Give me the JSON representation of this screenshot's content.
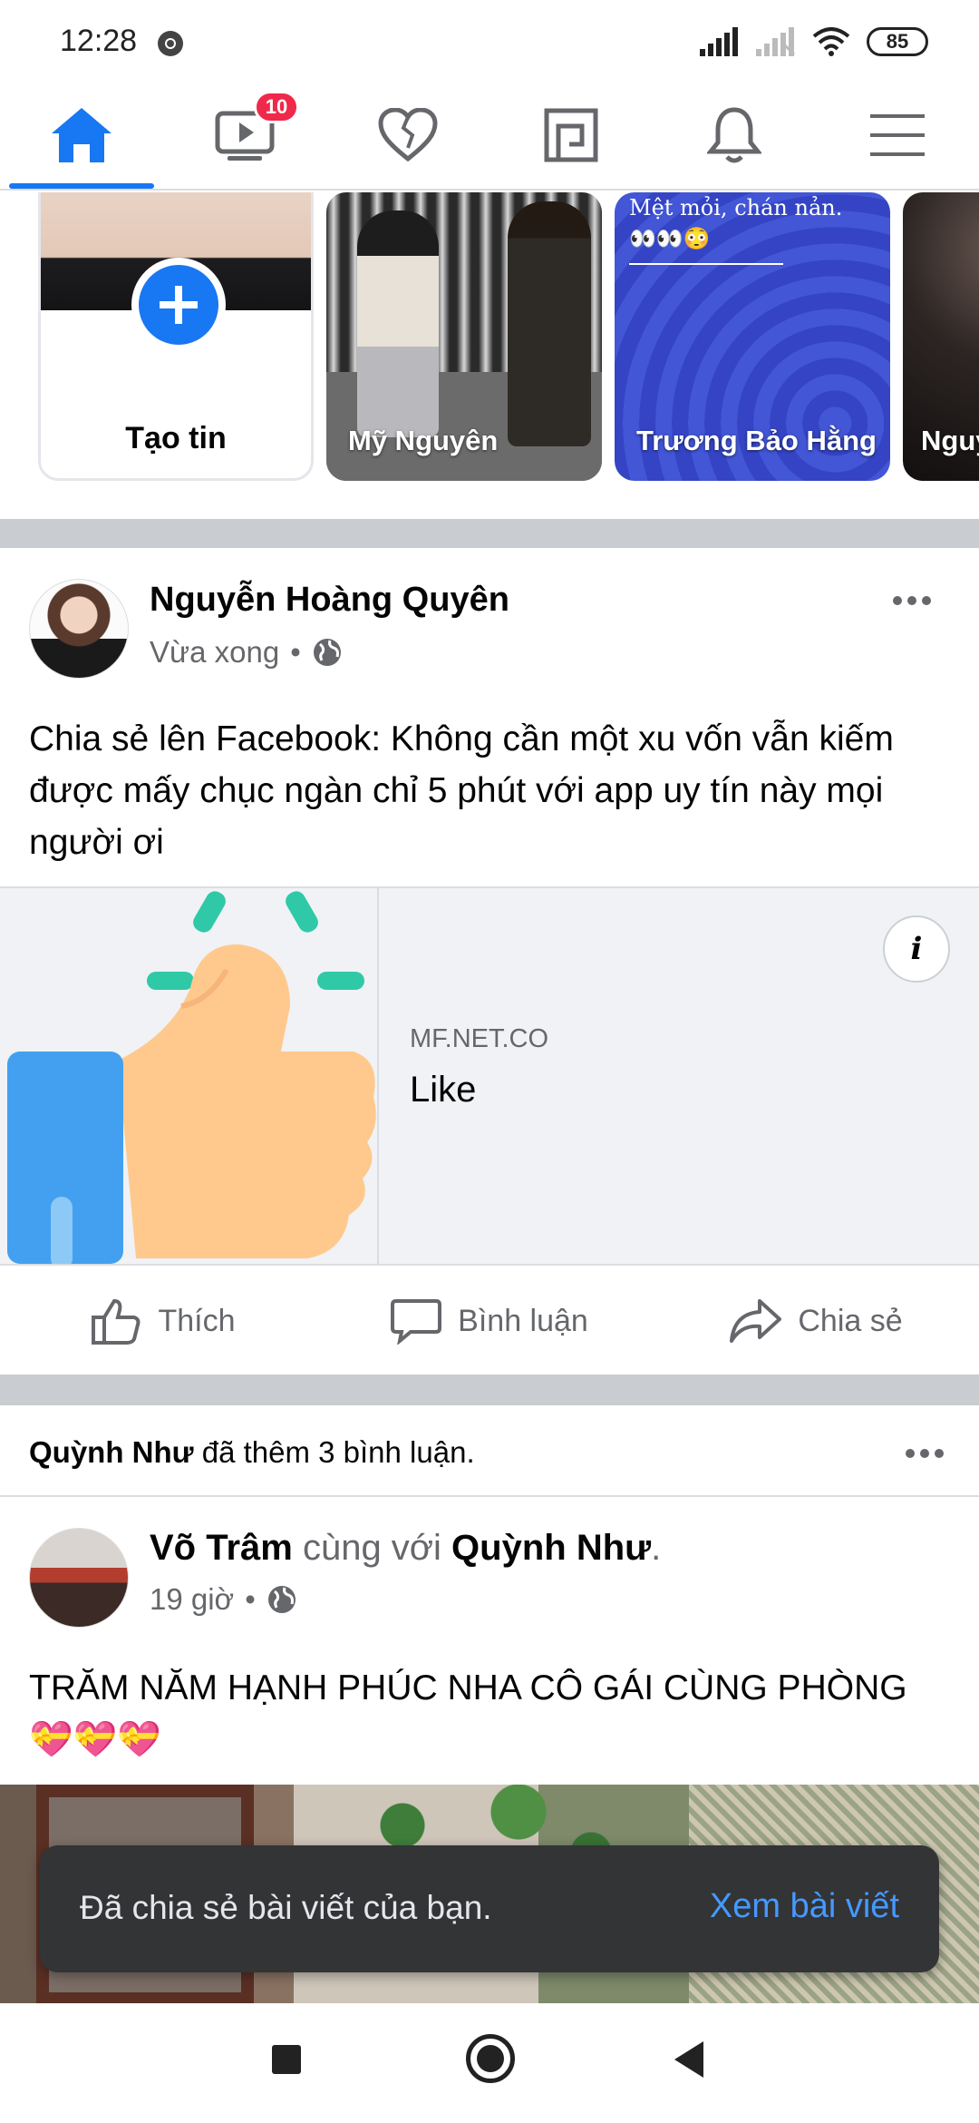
{
  "status_bar": {
    "time": "12:28",
    "battery": "85"
  },
  "nav": {
    "watch_badge": "10"
  },
  "stories": [
    {
      "label": "Tạo tin"
    },
    {
      "name": "Mỹ Nguyên"
    },
    {
      "name": "Trương Bảo Hằng",
      "caption": "Mệt mỏi, chán nản.",
      "caption_emoji": "👀👀😳"
    },
    {
      "name": "Nguy Việt"
    }
  ],
  "post1": {
    "author": "Nguyễn Hoàng Quyên",
    "time": "Vừa xong",
    "text": "Chia sẻ lên Facebook: Không cần một xu vốn vẫn kiếm được mấy chục ngàn chỉ 5 phút với app uy tín này mọi người ơi",
    "link": {
      "domain": "MF.NET.CO",
      "title": "Like"
    },
    "actions": {
      "like": "Thích",
      "comment": "Bình luận",
      "share": "Chia sẻ"
    }
  },
  "activity": {
    "actor": "Quỳnh Như",
    "text": " đã thêm 3 bình luận."
  },
  "post2": {
    "author": "Võ Trâm",
    "with_text": " cùng với ",
    "tagged": "Quỳnh Như",
    "dot": ".",
    "time": "19 giờ",
    "text": "TRĂM NĂM HẠNH PHÚC NHA CÔ GÁI CÙNG PHÒNG 💝💝💝"
  },
  "snackbar": {
    "message": "Đã chia sẻ bài viết của bạn.",
    "action": "Xem bài viết"
  },
  "colors": {
    "brand": "#1877f2",
    "badge": "#f02849",
    "snackbar_action": "#4599ff"
  }
}
